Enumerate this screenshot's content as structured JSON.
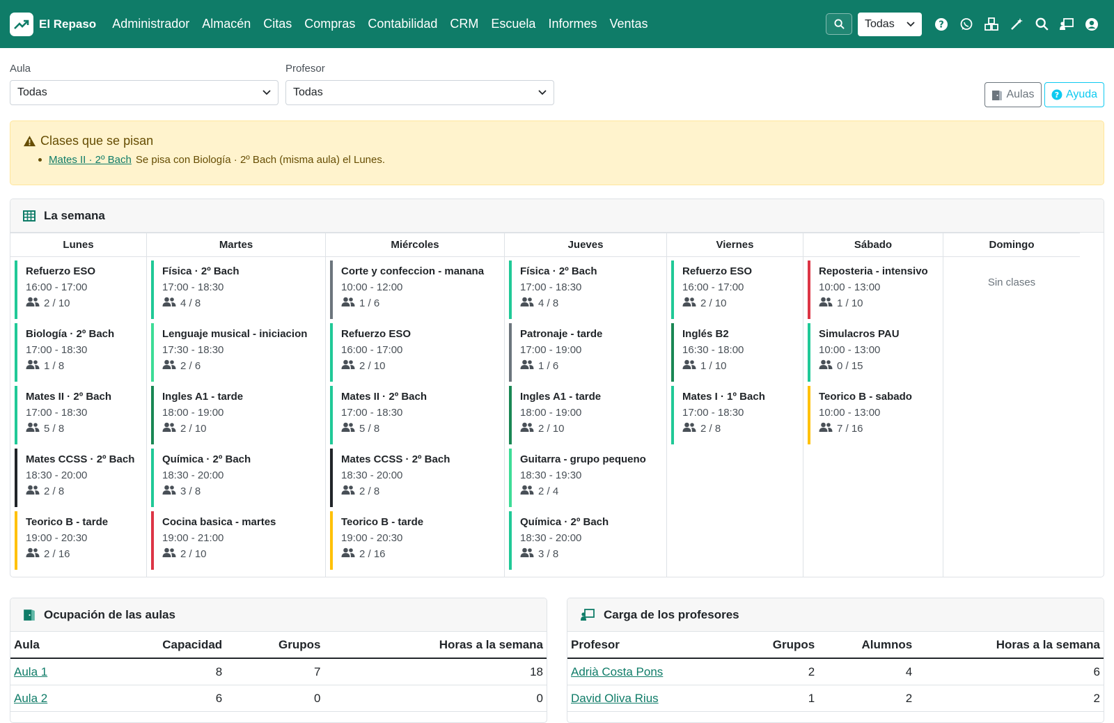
{
  "navbar": {
    "brand": "El Repaso",
    "menu": [
      "Administrador",
      "Almacén",
      "Citas",
      "Compras",
      "Contabilidad",
      "CRM",
      "Escuela",
      "Informes",
      "Ventas"
    ],
    "select_value": "Todas"
  },
  "filters": {
    "aula_label": "Aula",
    "aula_value": "Todas",
    "profesor_label": "Profesor",
    "profesor_value": "Todas",
    "btn_aulas": "Aulas",
    "btn_ayuda": "Ayuda"
  },
  "alert": {
    "title": "Clases que se pisan",
    "link": "Mates II · 2º Bach",
    "text": "Se pisa con Biología · 2º Bach (misma aula) el Lunes."
  },
  "week": {
    "title": "La semana",
    "days": [
      {
        "name": "Lunes",
        "classes": [
          {
            "title": "Refuerzo ESO",
            "time": "16:00 - 17:00",
            "count": "2 / 10",
            "color": "#20c997"
          },
          {
            "title": "Biología · 2º Bach",
            "time": "17:00 - 18:30",
            "count": "1 / 8",
            "color": "#20c997"
          },
          {
            "title": "Mates II · 2º Bach",
            "time": "17:00 - 18:30",
            "count": "5 / 8",
            "color": "#20c997"
          },
          {
            "title": "Mates CCSS · 2º Bach",
            "time": "18:30 - 20:00",
            "count": "2 / 8",
            "color": "#212529"
          },
          {
            "title": "Teorico B - tarde",
            "time": "19:00 - 20:30",
            "count": "2 / 16",
            "color": "#ffc107"
          }
        ]
      },
      {
        "name": "Martes",
        "classes": [
          {
            "title": "Física · 2º Bach",
            "time": "17:00 - 18:30",
            "count": "4 / 8",
            "color": "#20c997"
          },
          {
            "title": "Lenguaje musical - iniciacion",
            "time": "17:30 - 18:30",
            "count": "2 / 6",
            "color": "#3ddc97"
          },
          {
            "title": "Ingles A1 - tarde",
            "time": "18:00 - 19:00",
            "count": "2 / 10",
            "color": "#198754"
          },
          {
            "title": "Química · 2º Bach",
            "time": "18:30 - 20:00",
            "count": "3 / 8",
            "color": "#20c997"
          },
          {
            "title": "Cocina basica - martes",
            "time": "19:00 - 21:00",
            "count": "2 / 10",
            "color": "#dc3545"
          }
        ]
      },
      {
        "name": "Miércoles",
        "classes": [
          {
            "title": "Corte y confeccion - manana",
            "time": "10:00 - 12:00",
            "count": "1 / 6",
            "color": "#6c757d"
          },
          {
            "title": "Refuerzo ESO",
            "time": "16:00 - 17:00",
            "count": "2 / 10",
            "color": "#20c997"
          },
          {
            "title": "Mates II · 2º Bach",
            "time": "17:00 - 18:30",
            "count": "5 / 8",
            "color": "#20c997"
          },
          {
            "title": "Mates CCSS · 2º Bach",
            "time": "18:30 - 20:00",
            "count": "2 / 8",
            "color": "#212529"
          },
          {
            "title": "Teorico B - tarde",
            "time": "19:00 - 20:30",
            "count": "2 / 16",
            "color": "#ffc107"
          }
        ]
      },
      {
        "name": "Jueves",
        "classes": [
          {
            "title": "Física · 2º Bach",
            "time": "17:00 - 18:30",
            "count": "4 / 8",
            "color": "#20c997"
          },
          {
            "title": "Patronaje - tarde",
            "time": "17:00 - 19:00",
            "count": "1 / 6",
            "color": "#6c757d"
          },
          {
            "title": "Ingles A1 - tarde",
            "time": "18:00 - 19:00",
            "count": "2 / 10",
            "color": "#198754"
          },
          {
            "title": "Guitarra - grupo pequeno",
            "time": "18:30 - 19:30",
            "count": "2 / 4",
            "color": "#3ddc97"
          },
          {
            "title": "Química · 2º Bach",
            "time": "18:30 - 20:00",
            "count": "3 / 8",
            "color": "#20c997"
          }
        ]
      },
      {
        "name": "Viernes",
        "classes": [
          {
            "title": "Refuerzo ESO",
            "time": "16:00 - 17:00",
            "count": "2 / 10",
            "color": "#20c997"
          },
          {
            "title": "Inglés B2",
            "time": "16:30 - 18:00",
            "count": "1 / 10",
            "color": "#198754"
          },
          {
            "title": "Mates I · 1º Bach",
            "time": "17:00 - 18:30",
            "count": "2 / 8",
            "color": "#20c997"
          }
        ]
      },
      {
        "name": "Sábado",
        "classes": [
          {
            "title": "Reposteria - intensivo",
            "time": "10:00 - 13:00",
            "count": "1 / 10",
            "color": "#dc3545"
          },
          {
            "title": "Simulacros PAU",
            "time": "10:00 - 13:00",
            "count": "0 / 15",
            "color": "#20c997"
          },
          {
            "title": "Teorico B - sabado",
            "time": "10:00 - 13:00",
            "count": "7 / 16",
            "color": "#ffc107"
          }
        ]
      },
      {
        "name": "Domingo",
        "classes": [],
        "empty": "Sin clases"
      }
    ]
  },
  "aulas": {
    "title": "Ocupación de las aulas",
    "headers": [
      "Aula",
      "Capacidad",
      "Grupos",
      "Horas a la semana"
    ],
    "rows": [
      [
        "Aula 1",
        "8",
        "7",
        "18"
      ],
      [
        "Aula 2",
        "6",
        "0",
        "0"
      ]
    ]
  },
  "profesores": {
    "title": "Carga de los profesores",
    "headers": [
      "Profesor",
      "Grupos",
      "Alumnos",
      "Horas a la semana"
    ],
    "rows": [
      [
        "Adrià Costa Pons",
        "2",
        "4",
        "6"
      ],
      [
        "David Oliva Rius",
        "1",
        "2",
        "2"
      ]
    ]
  }
}
